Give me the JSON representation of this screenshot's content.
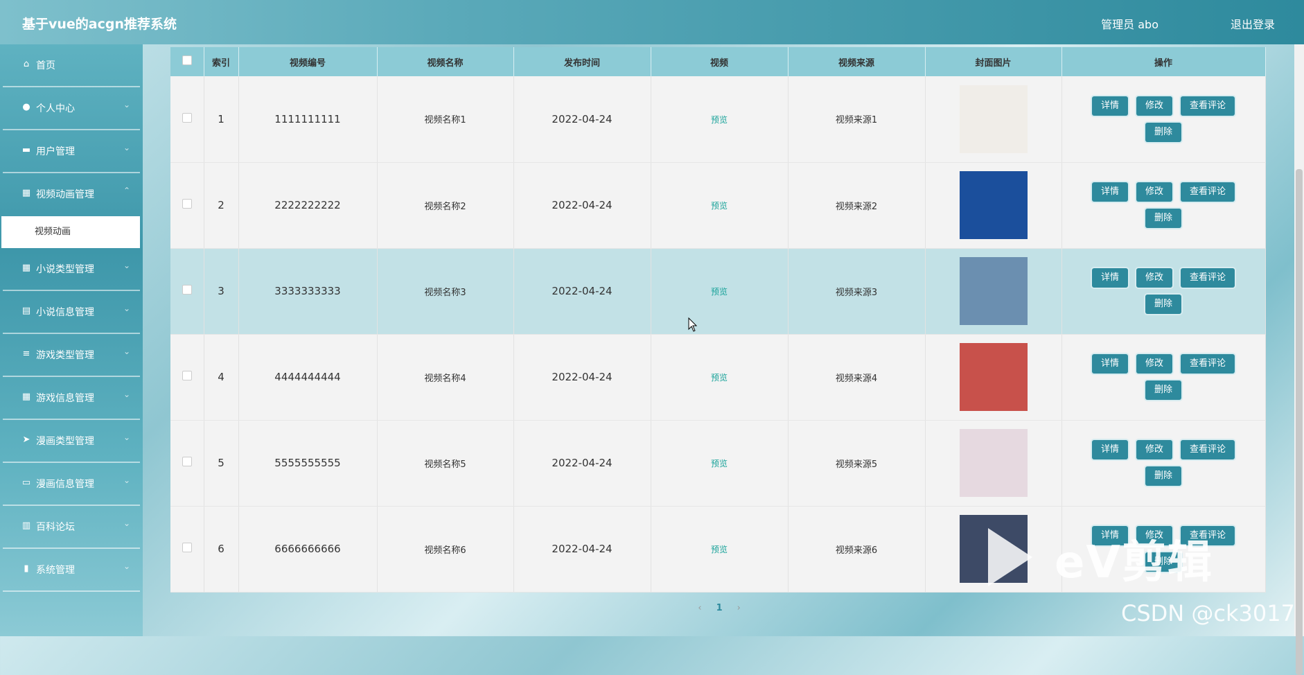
{
  "header": {
    "title": "基于vue的acgn推荐系统",
    "admin_label": "管理员 abo",
    "logout_label": "退出登录"
  },
  "sidebar": {
    "items": [
      {
        "label": "首页",
        "icon": "home-icon",
        "glyph": "⌂"
      },
      {
        "label": "个人中心",
        "icon": "user-icon",
        "glyph": "●"
      },
      {
        "label": "用户管理",
        "icon": "monitor-icon",
        "glyph": "▬"
      },
      {
        "label": "视频动画管理",
        "icon": "grid-icon",
        "glyph": "▦"
      },
      {
        "label": "小说类型管理",
        "icon": "grid-icon",
        "glyph": "▦"
      },
      {
        "label": "小说信息管理",
        "icon": "clipboard-icon",
        "glyph": "▤"
      },
      {
        "label": "游戏类型管理",
        "icon": "list-icon",
        "glyph": "≡"
      },
      {
        "label": "游戏信息管理",
        "icon": "grid-icon",
        "glyph": "▦"
      },
      {
        "label": "漫画类型管理",
        "icon": "send-icon",
        "glyph": "➤"
      },
      {
        "label": "漫画信息管理",
        "icon": "ticket-icon",
        "glyph": "▭"
      },
      {
        "label": "百科论坛",
        "icon": "book-icon",
        "glyph": "▥"
      },
      {
        "label": "系统管理",
        "icon": "bar-chart-icon",
        "glyph": "▮"
      }
    ],
    "active_submenu": "视频动画"
  },
  "table": {
    "columns": [
      "",
      "索引",
      "视频编号",
      "视频名称",
      "发布时间",
      "视频",
      "视频来源",
      "封面图片",
      "操作"
    ],
    "preview_label": "预览",
    "buttons": {
      "detail": "详情",
      "edit": "修改",
      "comments": "查看评论",
      "delete": "删除"
    },
    "rows": [
      {
        "index": "1",
        "code": "1111111111",
        "name": "视频名称1",
        "date": "2022-04-24",
        "source": "视频来源1",
        "cover_color": "#f0ede8"
      },
      {
        "index": "2",
        "code": "2222222222",
        "name": "视频名称2",
        "date": "2022-04-24",
        "source": "视频来源2",
        "cover_color": "#1b4f9c"
      },
      {
        "index": "3",
        "code": "3333333333",
        "name": "视频名称3",
        "date": "2022-04-24",
        "source": "视频来源3",
        "cover_color": "#6b8fb0"
      },
      {
        "index": "4",
        "code": "4444444444",
        "name": "视频名称4",
        "date": "2022-04-24",
        "source": "视频来源4",
        "cover_color": "#c8514b"
      },
      {
        "index": "5",
        "code": "5555555555",
        "name": "视频名称5",
        "date": "2022-04-24",
        "source": "视频来源5",
        "cover_color": "#e6d9e0"
      },
      {
        "index": "6",
        "code": "6666666666",
        "name": "视频名称6",
        "date": "2022-04-24",
        "source": "视频来源6",
        "cover_color": "#3d4a66"
      }
    ],
    "highlighted_row": 3
  },
  "pager": {
    "prev": "‹",
    "current": "1",
    "next": "›"
  },
  "watermark": {
    "ev": "eV剪辑",
    "csdn": "CSDN @ck3017"
  },
  "colors": {
    "accent": "#2e8a9d",
    "header_bg": "#8ccbd6",
    "preview": "#1aa39a"
  }
}
